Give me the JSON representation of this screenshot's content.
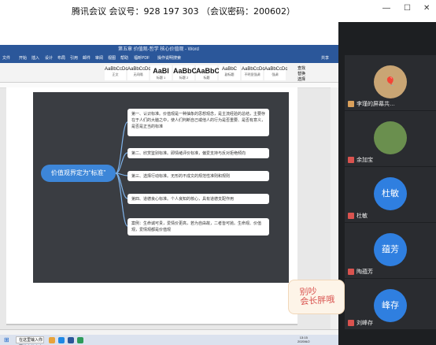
{
  "meeting": {
    "title": "腾讯会议  会议号：928 197 303  （会议密码：200602）"
  },
  "word": {
    "title": "第五章 价值观-哲学 核心价值观 - Word",
    "tabs": [
      "文件",
      "开始",
      "插入",
      "设计",
      "布局",
      "引用",
      "邮件",
      "审阅",
      "视图",
      "帮助",
      "福昕PDF",
      "操作说明搜索",
      "共享"
    ],
    "styles": [
      {
        "sample": "AaBbCcDc",
        "name": "正文"
      },
      {
        "sample": "AaBbCcDc",
        "name": "无间隔"
      },
      {
        "sample": "AaBl",
        "name": "标题 1"
      },
      {
        "sample": "AaBbC",
        "name": "标题 2"
      },
      {
        "sample": "AaBbC",
        "name": "标题"
      },
      {
        "sample": "AaBbC",
        "name": "副标题"
      },
      {
        "sample": "AaBbCcDc",
        "name": "不明显强调"
      },
      {
        "sample": "AaBbCcDc",
        "name": "强调"
      }
    ],
    "right_tools": [
      "查找",
      "替换",
      "选择"
    ]
  },
  "mindmap": {
    "central": "价值观界定为“标准”",
    "nodes": [
      "第一、认识标准。价值观是一种抽象的思想观念，是主流经验的总结，主要存在于人们的大脑之中，使人们判断自己或他人的行为是否重要、是否有意义，是否是正当的标准",
      "第二、欣赏鉴别标准。即情绪评价标准，偏爱支持与反对拒绝倾向",
      "第三、选择行动标准。无形的不成文的规范性准则和规则",
      "第四、道德良心标准。个人良知的核心，具有道德支配作用",
      "案例：生命诚可贵，爱情价更高，若为自由故，二者皆可抛。生命观、价值观，爱情观都是价值观"
    ]
  },
  "taskbar": {
    "search": "在这里输入你要搜索的内容",
    "time": "13:15",
    "date": "2020/6/2"
  },
  "participants": [
    {
      "name": "李瑾的屏幕共…",
      "avatar": "",
      "color": "#d9a05b"
    },
    {
      "name": "余加宝",
      "avatar": "",
      "color": "#6a8f4e"
    },
    {
      "name": "杜敏",
      "avatar": "杜敏",
      "color": "#2f7fe0"
    },
    {
      "name": "陶蕴芳",
      "avatar": "蕴芳",
      "color": "#2f7fe0"
    },
    {
      "name": "刘峰存",
      "avatar": "峰存",
      "color": "#2f7fe0"
    }
  ],
  "sticker": {
    "line1": "别吵",
    "line2": "会长胖哦"
  }
}
